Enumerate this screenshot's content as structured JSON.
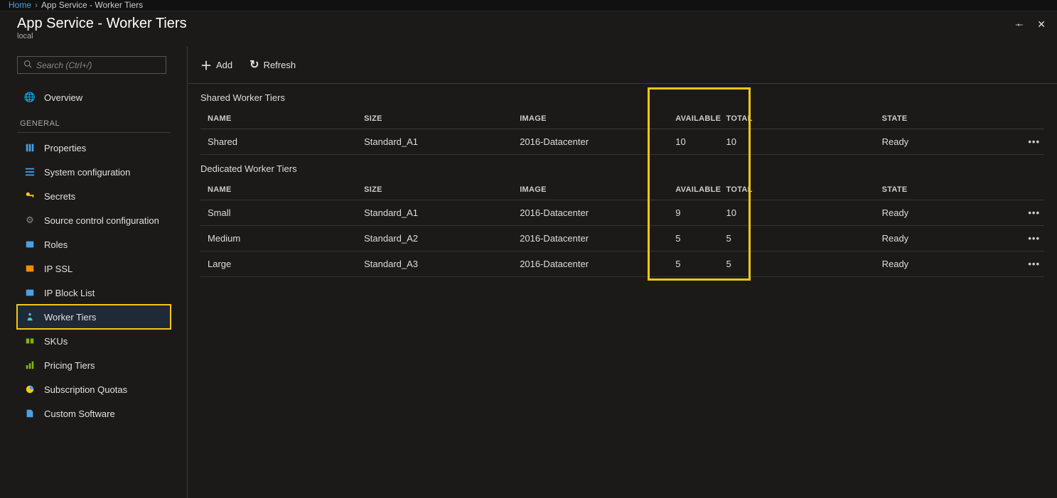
{
  "breadcrumb": {
    "home": "Home",
    "current": "App Service - Worker Tiers"
  },
  "page": {
    "title": "App Service - Worker Tiers",
    "subtitle": "local"
  },
  "search": {
    "placeholder": "Search (Ctrl+/)"
  },
  "sidebar": {
    "overview": "Overview",
    "general_label": "GENERAL",
    "items": [
      {
        "label": "Properties"
      },
      {
        "label": "System configuration"
      },
      {
        "label": "Secrets"
      },
      {
        "label": "Source control configuration"
      },
      {
        "label": "Roles"
      },
      {
        "label": "IP SSL"
      },
      {
        "label": "IP Block List"
      },
      {
        "label": "Worker Tiers"
      },
      {
        "label": "SKUs"
      },
      {
        "label": "Pricing Tiers"
      },
      {
        "label": "Subscription Quotas"
      },
      {
        "label": "Custom Software"
      }
    ]
  },
  "toolbar": {
    "add": "Add",
    "refresh": "Refresh"
  },
  "headers": {
    "name": "NAME",
    "size": "SIZE",
    "image": "IMAGE",
    "available": "AVAILABLE",
    "total": "TOTAL",
    "state": "STATE"
  },
  "shared": {
    "title": "Shared Worker Tiers",
    "rows": [
      {
        "name": "Shared",
        "size": "Standard_A1",
        "image": "2016-Datacenter",
        "available": "10",
        "total": "10",
        "state": "Ready"
      }
    ]
  },
  "dedicated": {
    "title": "Dedicated Worker Tiers",
    "rows": [
      {
        "name": "Small",
        "size": "Standard_A1",
        "image": "2016-Datacenter",
        "available": "9",
        "total": "10",
        "state": "Ready"
      },
      {
        "name": "Medium",
        "size": "Standard_A2",
        "image": "2016-Datacenter",
        "available": "5",
        "total": "5",
        "state": "Ready"
      },
      {
        "name": "Large",
        "size": "Standard_A3",
        "image": "2016-Datacenter",
        "available": "5",
        "total": "5",
        "state": "Ready"
      }
    ]
  },
  "more": "•••"
}
